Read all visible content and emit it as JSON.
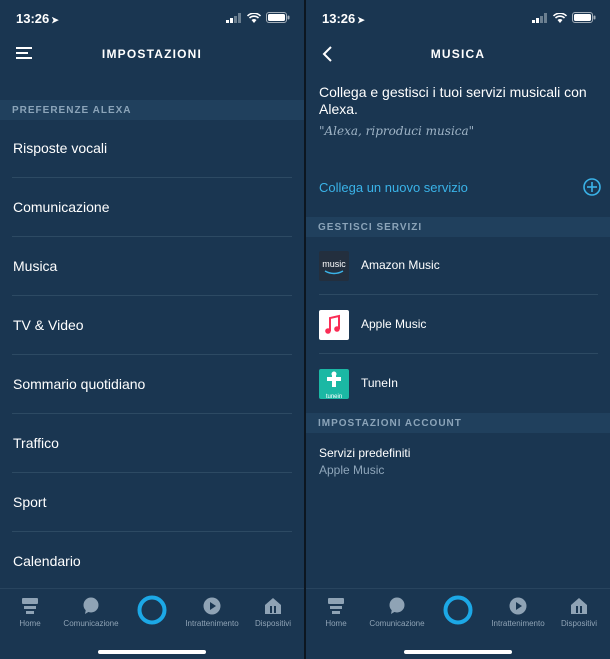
{
  "left": {
    "status": {
      "time": "13:26"
    },
    "title": "IMPOSTAZIONI",
    "section": "PREFERENZE ALEXA",
    "items": [
      "Risposte vocali",
      "Comunicazione",
      "Musica",
      "TV & Video",
      "Sommario quotidiano",
      "Traffico",
      "Sport",
      "Calendario"
    ]
  },
  "right": {
    "status": {
      "time": "13:26"
    },
    "title": "MUSICA",
    "intro": "Collega e gestisci i tuoi servizi musicali con Alexa.",
    "quote": "\"Alexa, riproduci musica\"",
    "connect_label": "Collega un nuovo servizio",
    "manage_section": "GESTISCI SERVIZI",
    "services": [
      {
        "name": "Amazon Music",
        "icon": "amazon-music-icon",
        "icon_text": "music"
      },
      {
        "name": "Apple Music",
        "icon": "apple-music-icon"
      },
      {
        "name": "TuneIn",
        "icon": "tunein-icon",
        "icon_text": "tunein"
      }
    ],
    "account_section": "IMPOSTAZIONI ACCOUNT",
    "account_item": {
      "title": "Servizi predefiniti",
      "value": "Apple Music"
    }
  },
  "tabs": [
    "Home",
    "Comunicazione",
    "Intrattenimento",
    "Dispositivi"
  ],
  "colors": {
    "background": "#1a3651",
    "section": "#20405d",
    "accent": "#3ab3e8",
    "alexa": "#1ca8e6"
  }
}
